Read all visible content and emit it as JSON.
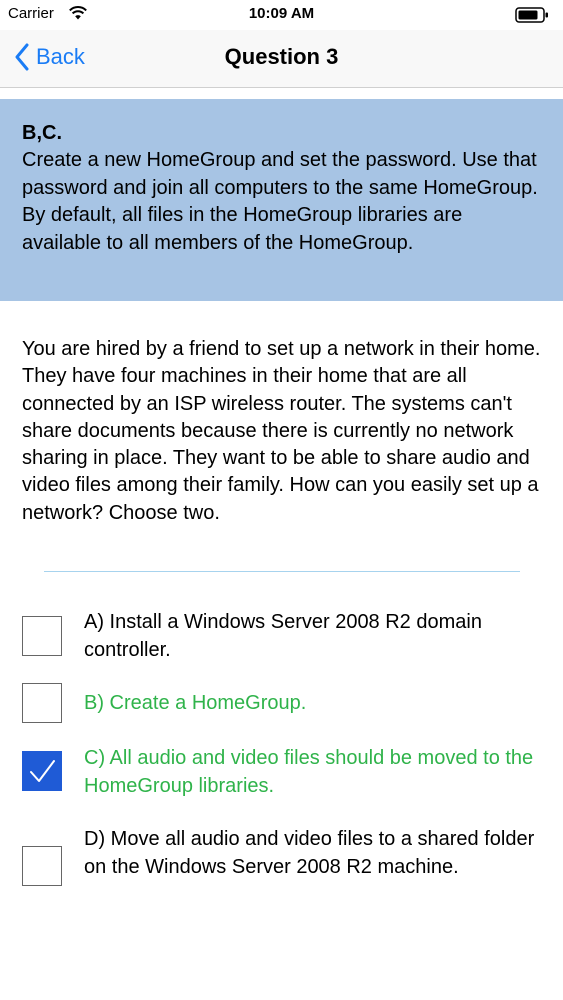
{
  "status_bar": {
    "carrier": "Carrier",
    "time": "10:09 AM",
    "wifi_icon": "wifi-icon",
    "battery_icon": "battery-icon"
  },
  "nav": {
    "back_label": "Back",
    "title": "Question 3",
    "accent_color": "#1a7cf5"
  },
  "answer": {
    "key": "B,C.",
    "explanation": "Create a new HomeGroup and set the password. Use that password and join all computers to the same HomeGroup. By default, all files in the HomeGroup libraries are available to all members of the HomeGroup.",
    "background_color": "#a7c4e4"
  },
  "question": {
    "text": "You are hired by a friend to set up a network in their home. They have four machines in their home that are all connected by an ISP wireless router. The systems can't share documents because there is currently no network sharing in place. They want to be able to share audio and video files among their family. How can you easily set up a network? Choose two."
  },
  "options": [
    {
      "label": "A) Install a Windows Server 2008 R2 domain controller.",
      "checked": false,
      "correct": false
    },
    {
      "label": "B) Create a HomeGroup.",
      "checked": false,
      "correct": true
    },
    {
      "label": "C) All audio and video files should be moved to the HomeGroup libraries.",
      "checked": true,
      "correct": true
    },
    {
      "label": "D) Move all audio and video files to a shared folder on the Windows Server 2008 R2 machine.",
      "checked": false,
      "correct": false
    }
  ],
  "colors": {
    "correct_text": "#2fb34a",
    "checkbox_checked": "#1f5bd6"
  }
}
